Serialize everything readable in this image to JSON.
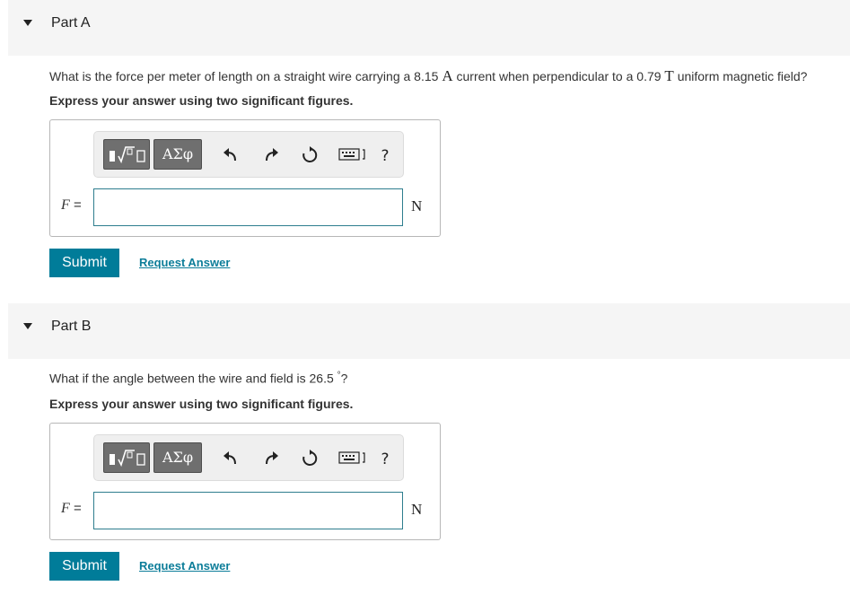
{
  "parts": [
    {
      "title": "Part A",
      "question_text": "What is the force per meter of length on a straight wire carrying a 8.15 ",
      "q_unit1": "A",
      "question_mid": " current when perpendicular to a 0.79 ",
      "q_unit2": "T",
      "question_end": " uniform magnetic field?",
      "instruction": "Express your answer using two significant figures.",
      "variable": "F",
      "equals": "=",
      "answer_value": "",
      "unit": "N",
      "submit_label": "Submit",
      "request_label": "Request Answer"
    },
    {
      "title": "Part B",
      "question_text": "What if the angle between the wire and field is 26.5 ",
      "q_degree": "°",
      "question_end": "?",
      "instruction": "Express your answer using two significant figures.",
      "variable": "F",
      "equals": "=",
      "answer_value": "",
      "unit": "N",
      "submit_label": "Submit",
      "request_label": "Request Answer"
    }
  ],
  "toolbar": {
    "templates_icon": "templates-icon",
    "greek_label": "ΑΣφ",
    "undo_icon": "undo-icon",
    "redo_icon": "redo-icon",
    "reset_icon": "reset-icon",
    "keyboard_icon": "keyboard-icon",
    "help_label": "?"
  },
  "colors": {
    "submit_bg": "#007c99",
    "link": "#0c7d99",
    "header_bg": "#f5f5f5",
    "input_border": "#2e7d8e"
  }
}
